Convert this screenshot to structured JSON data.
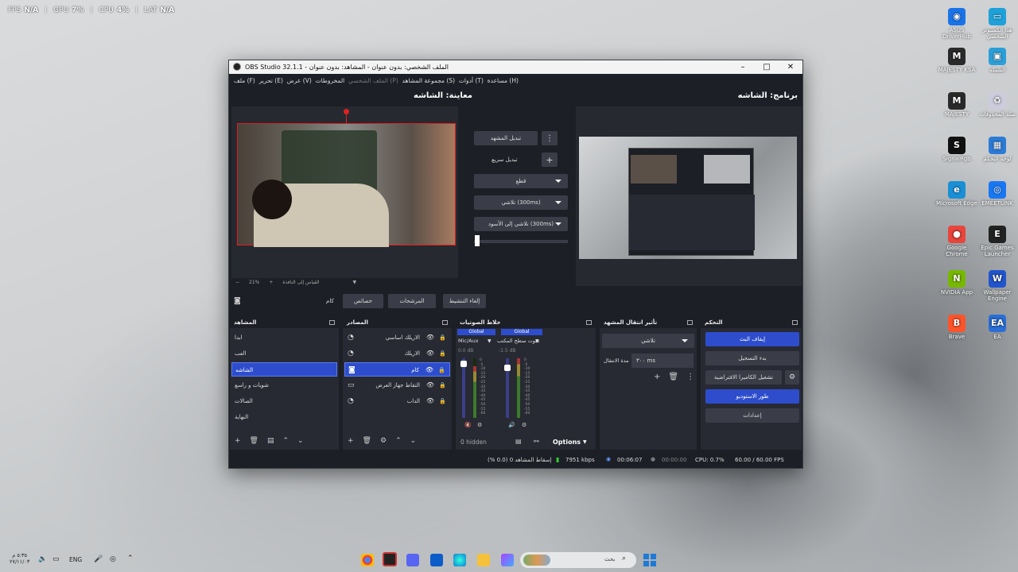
{
  "perf": {
    "fps_label": "FPS",
    "fps": "N/A",
    "gpu_label": "GPU",
    "gpu": "7%",
    "cpu_label": "CPU",
    "cpu": "4%",
    "lat_label": "LAT",
    "lat": "N/A"
  },
  "desktop_icons": [
    {
      "label": "ASUS DriverHub",
      "color": "#1a73e8",
      "glyph": "◉"
    },
    {
      "label": "هذا الكمبيوتر الشخصي",
      "color": "#1ea1d9",
      "glyph": "▭"
    },
    {
      "label": "MAJESTY KSA",
      "color": "#2a2a2a",
      "glyph": "M"
    },
    {
      "label": "الشبكة",
      "color": "#2b9fd8",
      "glyph": "▣"
    },
    {
      "label": "MAJESTY",
      "color": "#2a2a2a",
      "glyph": "M"
    },
    {
      "label": "سلة المحذوفات",
      "color": "#ccd",
      "glyph": "♻"
    },
    {
      "label": "SignalRgb",
      "color": "#111",
      "glyph": "S"
    },
    {
      "label": "لوحة التحكم",
      "color": "#2c7bd6",
      "glyph": "▦"
    },
    {
      "label": "Microsoft Edge",
      "color": "#1a8fd6",
      "glyph": "e"
    },
    {
      "label": "EMEETLINK",
      "color": "#1877f2",
      "glyph": "◎"
    },
    {
      "label": "Google Chrome",
      "color": "#e8453c",
      "glyph": "●"
    },
    {
      "label": "Epic Games Launcher",
      "color": "#222",
      "glyph": "E"
    },
    {
      "label": "NVIDIA App",
      "color": "#76b900",
      "glyph": "N"
    },
    {
      "label": "Wallpaper Engine",
      "color": "#2255cc",
      "glyph": "W"
    },
    {
      "label": "Brave",
      "color": "#fb542b",
      "glyph": "B"
    },
    {
      "label": "EA",
      "color": "#2a6fd6",
      "glyph": "EA"
    }
  ],
  "window": {
    "title": "OBS Studio 32.1.1 - الملف الشخصي: بدون عنوان - المشاهد: بدون عنوان",
    "menu": [
      "ملف (F)",
      "تحرير (E)",
      "عرض (V)",
      "المخروطات",
      "الملف الشخصي (P)",
      "مجموعة المشاهد (S)",
      "أدوات (T)",
      "مساعدة (H)"
    ],
    "preview_label": "معاينة: الشاشه",
    "program_label": "برنامج: الشاشه",
    "zoom": "21%",
    "zoom_mode": "القياس إلى النافذة",
    "transition": {
      "switch_scene": "تبديل المشهد",
      "quick_switch": "تبديل سريع",
      "cut": "قطع",
      "fade": "تلاشي (300ms)",
      "fade_black": "تلاشي إلى الأسود (300ms)"
    },
    "source_bar": {
      "name": "كام",
      "properties": "خصائص",
      "filters": "المرشحات",
      "deactivate": "إلغاء التنشيط"
    },
    "scenes": {
      "title": "المشاهد",
      "items": [
        "ابدا",
        "العب",
        "الشاشه",
        "شويات و راسع",
        "الصالات",
        "النهاية"
      ],
      "selected": 2
    },
    "sources": {
      "title": "المصادر",
      "items": [
        {
          "name": "الاريلك اساسي",
          "type": "audio"
        },
        {
          "name": "الاريلك",
          "type": "audio"
        },
        {
          "name": "كام",
          "type": "camera"
        },
        {
          "name": "التقاط جهاز العرض",
          "type": "monitor"
        },
        {
          "name": "الداب",
          "type": "audio"
        }
      ],
      "selected": 2
    },
    "mixer": {
      "title": "خلاط الصوتيات",
      "ch1_tag": "Global",
      "ch1_name": "Mic/Aux",
      "ch1_db": "0.0 dB",
      "ch2_tag": "Global",
      "ch2_name": "صوت سطح المكتب",
      "ch2_db": "-1.5 dB",
      "hidden": "0 hidden",
      "options": "Options",
      "scale": [
        "0",
        "-5",
        "-10",
        "-15",
        "-20",
        "-25",
        "-30",
        "-35",
        "-40",
        "-45",
        "-50",
        "-55",
        "-60"
      ]
    },
    "transitions_dock": {
      "title": "تأثير انتقال المشهد",
      "type": "تلاشي",
      "duration_label": "مدة الانتقال",
      "duration": "٣٠٠ ms"
    },
    "controls": {
      "title": "التحكم",
      "stop_stream": "إيقاف البث",
      "start_record": "بدء التسجيل",
      "virtual_cam": "تشغيل الكاميرا الافتراضية",
      "studio_mode": "طور الاستوديو",
      "settings": "إعدادات"
    },
    "status": {
      "dropped": "إسقاط المشاهد 0 (0.0 %)",
      "bitrate": "7951 kbps",
      "stream_time": "00:06:07",
      "rec_time": "00:00:00",
      "cpu": "CPU: 0.7%",
      "fps": "60.00 / 60.00 FPS"
    }
  },
  "tray": {
    "time": "٥:٣٥ م",
    "date": "٢٧/١١/٠٣",
    "lang": "ENG",
    "search": "بحث"
  }
}
